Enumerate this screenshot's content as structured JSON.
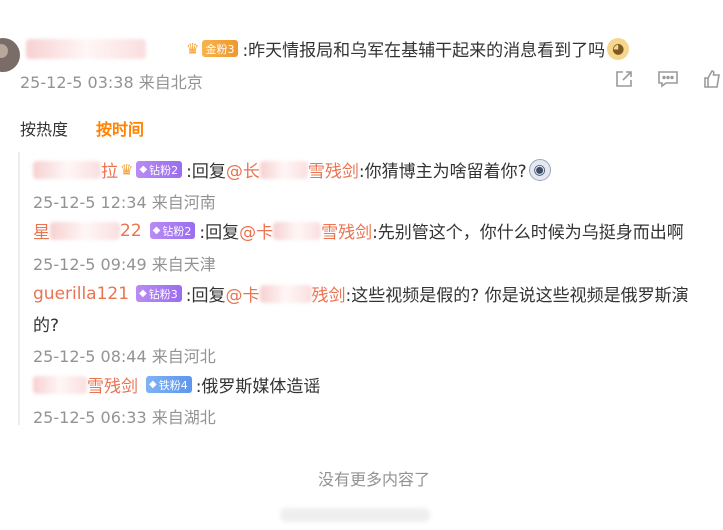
{
  "post": {
    "text": ":昨天情报局和乌军在基辅干起来的消息看到了吗",
    "badge": "金粉3",
    "time": "25-12-5 03:38",
    "location": "来自北京",
    "emoji_icon": "doge-emoji"
  },
  "actions": {
    "icons": [
      "share-icon",
      "comment-icon",
      "like-icon"
    ]
  },
  "sort": {
    "hot": "按热度",
    "time": "按时间"
  },
  "replies": [
    {
      "user_suffix": "拉",
      "badge": "钻粉2",
      "reply_prefix": ":回复",
      "mention_start": "@长",
      "mention_end": "雪残剑",
      "text": ":你猜博主为啥留着你?",
      "time": "25-12-5 12:34",
      "location": "来自河南",
      "emoji_icon": "husky-emoji"
    },
    {
      "user_prefix": "星",
      "user_suffix": "22",
      "badge": "钻粉2",
      "reply_prefix": ":回复",
      "mention_start": "@卡",
      "mention_end": "雪残剑",
      "text": ":先别管这个，你什么时候为乌挺身而出啊",
      "time": "25-12-5 09:49",
      "location": "来自天津"
    },
    {
      "user": "guerilla121",
      "badge": "钻粉3",
      "reply_prefix": ":回复",
      "mention_start": "@卡",
      "mention_end": "残剑",
      "text": ":这些视频是假的? 你是说这些视频是俄罗斯演",
      "text_cont": "的?",
      "time": "25-12-5 08:44",
      "location": "来自河北"
    },
    {
      "user_suffix": "雪残剑",
      "badge": "铁粉4",
      "text": ":俄罗斯媒体造谣",
      "time": "25-12-5 06:33",
      "location": "来自湖北"
    }
  ],
  "end_note": "没有更多内容了",
  "colors": {
    "link": "#eb7350",
    "accent": "#ff8200",
    "meta": "#939393"
  }
}
